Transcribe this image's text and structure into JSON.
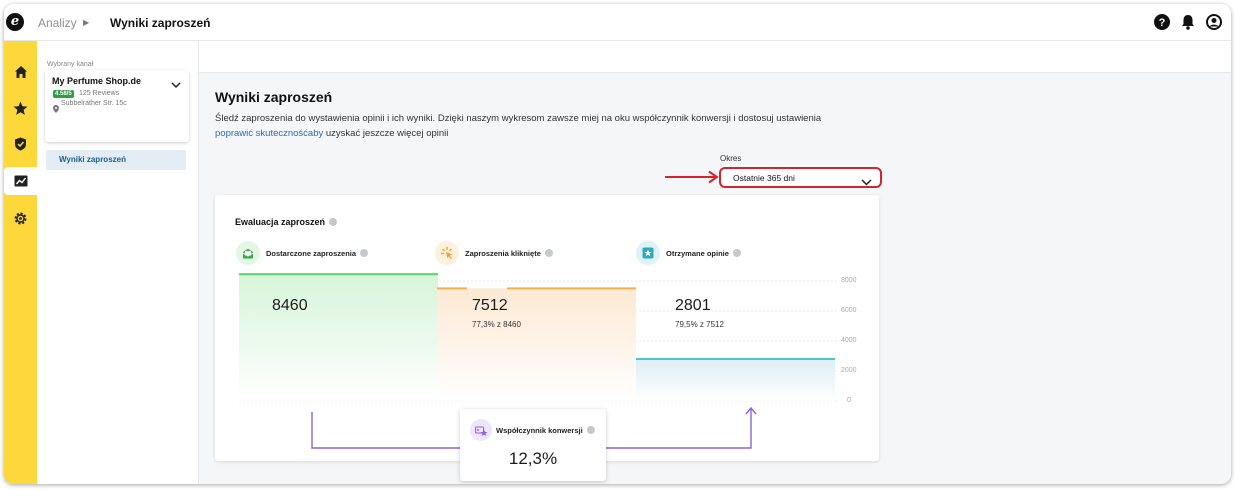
{
  "breadcrumb": {
    "parent": "Analizy",
    "current": "Wyniki zaproszeń"
  },
  "topbar_icons": [
    "help-icon",
    "bell-icon",
    "user-icon"
  ],
  "rail": {
    "items": [
      "home-icon",
      "star-icon",
      "shield-icon",
      "chart-icon",
      "gear-icon"
    ],
    "active": "chart-icon",
    "color": "#fdd83a"
  },
  "sidebar": {
    "channel_label": "Wybrany kanał",
    "shop": {
      "name": "My Perfume Shop.de",
      "score": "4.58/5",
      "reviews": "125 Reviews",
      "address": "Subbelrather Str. 15c"
    },
    "active_item": "Wyniki zaproszeń"
  },
  "page": {
    "title": "Wyniki zaproszeń",
    "description": "Śledź zaproszenia do wystawienia opinii i ich wyniki. Dzięki naszym wykresom zawsze miej na oku współczynnik konwersji i dostosuj ustawienia",
    "link_text": "poprawić skutecznośćaby",
    "description_tail": " uzyskać jeszcze więcej opinii"
  },
  "period": {
    "label": "Okres",
    "value": "Ostatnie 365 dni",
    "highlight_color": "#d5232f"
  },
  "card": {
    "title": "Ewaluacja zaproszeń",
    "metrics": [
      {
        "label": "Dostarczone zaproszenia",
        "value": "8460",
        "sub": ""
      },
      {
        "label": "Zaproszenia kliknięte",
        "value": "7512",
        "sub": "77,3% z 8460"
      },
      {
        "label": "Otrzymane opinie",
        "value": "2801",
        "sub": "79,5% z 7512"
      }
    ],
    "conversion": {
      "label": "Współczynnik konwersji",
      "value": "12,3%"
    }
  },
  "chart_data": {
    "type": "bar",
    "categories": [
      "Dostarczone zaproszenia",
      "Zaproszenia kliknięte",
      "Otrzymane opinie"
    ],
    "values": [
      8460,
      7512,
      2801
    ],
    "yticks": [
      "8000",
      "6000",
      "4000",
      "2000",
      "0"
    ],
    "ylim": [
      0,
      8000
    ],
    "colors": [
      "#5ed66a",
      "#f5b04a",
      "#4fc4d4"
    ]
  }
}
